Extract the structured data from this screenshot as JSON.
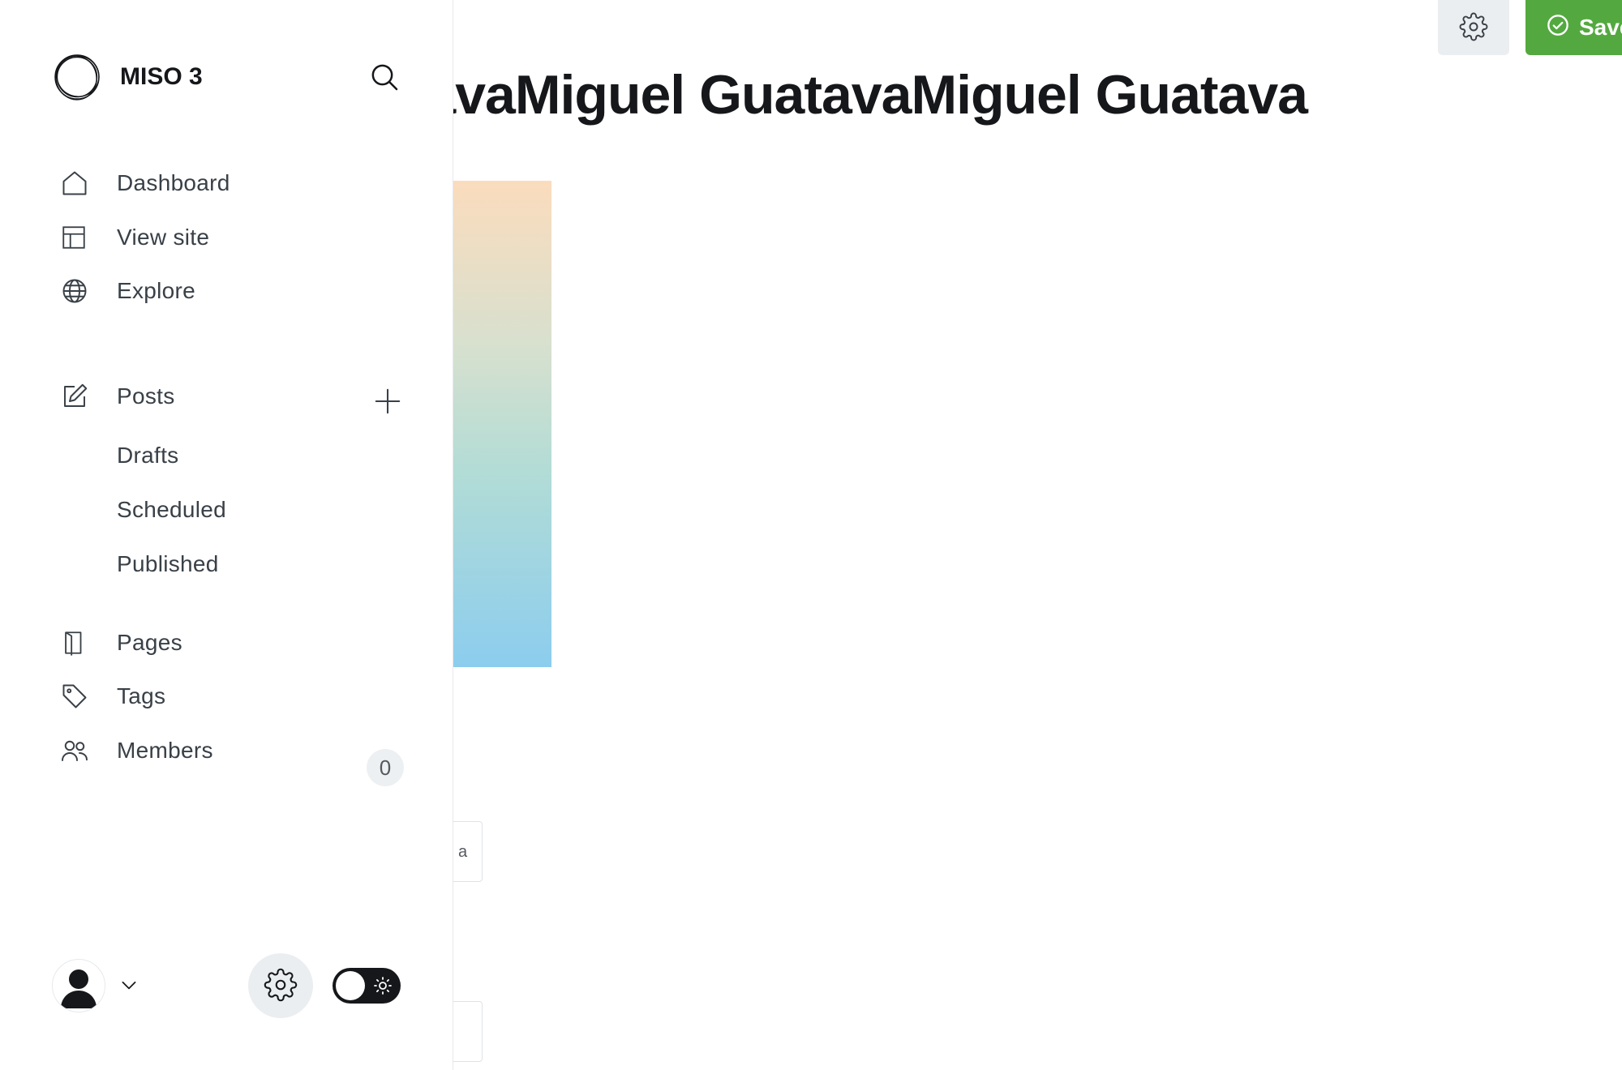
{
  "brand": {
    "name": "MISO 3",
    "logo": "circle-scribble-logo"
  },
  "nav": {
    "dashboard": "Dashboard",
    "view_site": "View site",
    "explore": "Explore",
    "posts": "Posts",
    "drafts": "Drafts",
    "scheduled": "Scheduled",
    "published": "Published",
    "pages": "Pages",
    "tags": "Tags",
    "members": "Members",
    "members_count": "0"
  },
  "editor": {
    "title": "Miguel GuatavaMiguel GuatavaMiguel Guatava",
    "save_label": "Save",
    "field_fragment": "a"
  },
  "icons": {
    "search": "search-icon",
    "dashboard": "home-icon",
    "view_site": "layout-icon",
    "explore": "globe-icon",
    "posts": "edit-icon",
    "add": "plus-icon",
    "pages": "page-icon",
    "tags": "tag-icon",
    "members": "users-icon",
    "settings": "gear-icon",
    "theme": "sun-icon",
    "save": "check-circle-icon"
  },
  "colors": {
    "save_green": "#53a93f",
    "text_dark": "#15171a",
    "nav_text": "#394047",
    "badge_bg": "#edf0f2"
  },
  "theme_toggle": {
    "mode": "light"
  }
}
